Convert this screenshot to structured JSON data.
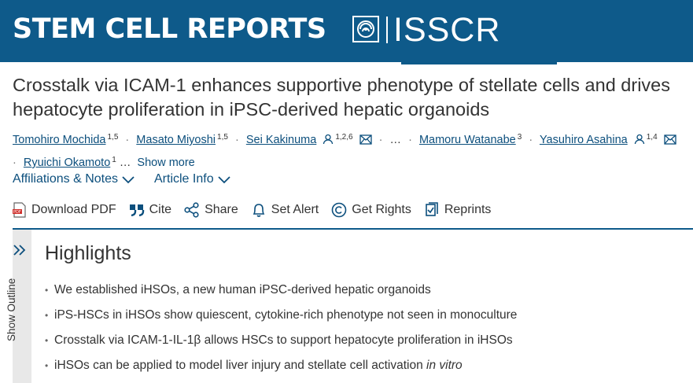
{
  "header": {
    "brand": "STEM CELL REPORTS",
    "org": "ISSCR",
    "colors": {
      "header_bg": "#0e5a8a",
      "link": "#0c4f7d"
    }
  },
  "article": {
    "title": "Crosstalk via ICAM-1 enhances supportive phenotype of stellate cells and drives hepatocyte proliferation in iPSC-derived hepatic organoids",
    "authors": [
      {
        "name": "Tomohiro Mochida",
        "sup": "1,5"
      },
      {
        "name": "Masato Miyoshi",
        "sup": "1,5"
      },
      {
        "name": "Sei Kakinuma",
        "sup": "1,2,6"
      },
      {
        "name": "Mamoru Watanabe",
        "sup": "3"
      },
      {
        "name": "Yasuhiro Asahina",
        "sup": "1,4"
      },
      {
        "name": "Ryuichi Okamoto",
        "sup": "1"
      }
    ],
    "ellipsis": "…",
    "show_more": "Show more"
  },
  "meta_links": {
    "affiliations": "Affiliations & Notes",
    "article_info": "Article Info"
  },
  "toolbar": {
    "download_pdf": "Download PDF",
    "cite": "Cite",
    "share": "Share",
    "set_alert": "Set Alert",
    "get_rights": "Get Rights",
    "reprints": "Reprints"
  },
  "outline": {
    "label": "Show Outline"
  },
  "highlights": {
    "title": "Highlights",
    "items": [
      "We established iHSOs, a new human iPSC-derived hepatic organoids",
      "iPS-HSCs in iHSOs show quiescent, cytokine-rich phenotype not seen in monoculture",
      "Crosstalk via ICAM-1-IL-1β allows HSCs to support hepatocyte proliferation in iHSOs",
      "iHSOs can be applied to model liver injury and stellate cell activation"
    ],
    "last_item_emphasis": "in vitro"
  }
}
